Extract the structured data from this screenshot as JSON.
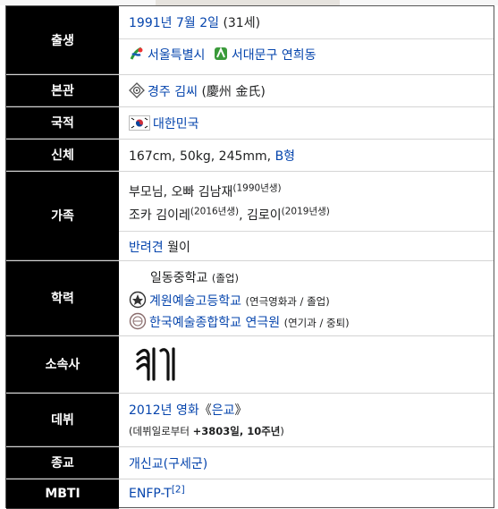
{
  "rows": {
    "birth": {
      "label": "출생",
      "date_link": "1991년 7월 2일",
      "age": "(31세)",
      "city_link": "서울특별시",
      "district_link": "서대문구 연희동"
    },
    "clan": {
      "label": "본관",
      "clan_link": "경주 김씨",
      "hanja": "(慶州 金氏)"
    },
    "nationality": {
      "label": "국적",
      "country_link": "대한민국"
    },
    "body": {
      "label": "신체",
      "measurements": "167cm, 50kg, 245mm,",
      "blood_link": "B형"
    },
    "family": {
      "label": "가족",
      "line1_prefix": "부모님, 오빠 김남재",
      "line1_sup": "(1990년생)",
      "line2_prefix": "조카 김이레",
      "line2_sup1": "(2016년생)",
      "line2_mid": ", 김로이",
      "line2_sup2": "(2019년생)",
      "pet_link": "반려견",
      "pet_name": "월이"
    },
    "education": {
      "label": "학력",
      "school1": "일동중학교",
      "school1_note": "(졸업)",
      "school2_link": "계원예술고등학교",
      "school2_note": "(연극영화과 / 졸업)",
      "school3_link": "한국예술종합학교 연극원",
      "school3_note": "(연기과 / 중퇴)"
    },
    "agency": {
      "label": "소속사"
    },
    "debut": {
      "label": "데뷔",
      "year_link": "2012년 영화",
      "film_open": "《",
      "film_link": "은교",
      "film_close": "》",
      "since_prefix": "(데뷔일로부터",
      "since_value": "+3803일, 10주년",
      "since_suffix": ")"
    },
    "religion": {
      "label": "종교",
      "religion_link": "개신교(구세군)"
    },
    "mbti": {
      "label": "MBTI",
      "type_link": "ENFP-T",
      "ref": "[2]"
    }
  },
  "colors": {
    "header_bg": "#000000",
    "header_text": "#ffffff",
    "link": "#0645ad",
    "text": "#202122"
  },
  "icons": {
    "seoul_logo": "seoul-symbol-icon",
    "district_logo": "seodaemun-symbol-icon",
    "clan_emblem": "clan-emblem-icon",
    "flag": "south-korea-flag-icon",
    "school2_emblem": "school-emblem-icon",
    "school3_emblem": "knua-emblem-icon",
    "agency_logo": "agency-logo-icon"
  }
}
